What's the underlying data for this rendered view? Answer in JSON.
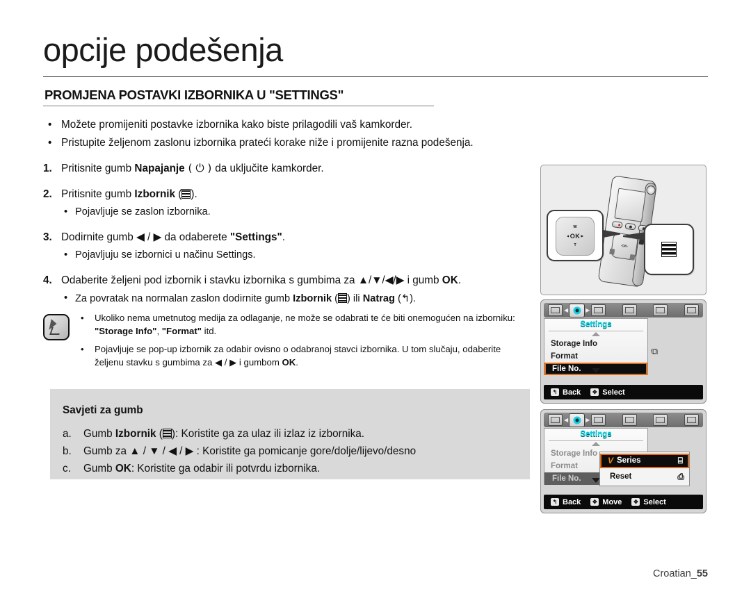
{
  "header": {
    "title": "opcije podešenja",
    "subtitle": "PROMJENA POSTAVKI IZBORNIKA U \"SETTINGS\""
  },
  "intro_bullets": [
    "Možete promijeniti postavke izbornika kako biste prilagodili vaš kamkorder.",
    "Pristupite željenom zaslonu izbornika prateći korake niže i promijenite razna podešenja."
  ],
  "steps": [
    {
      "num": "1.",
      "text_before": "Pritisnite gumb ",
      "bold": "Napajanje",
      "text_after": " (  ) da uključite kamkorder.",
      "sub": []
    },
    {
      "num": "2.",
      "text_before": "Pritisnite gumb ",
      "bold": "Izbornik",
      "text_after": " ( ).",
      "sub": [
        "Pojavljuje se zaslon izbornika."
      ]
    },
    {
      "num": "3.",
      "text_before": "Dodirnite gumb ◀ / ▶ da odaberete ",
      "bold": "\"Settings\"",
      "text_after": ".",
      "sub": [
        "Pojavljuju se izbornici u načinu Settings."
      ]
    },
    {
      "num": "4.",
      "text_before": "Odaberite željeni pod izbornik i stavku izbornika s gumbima za ▲/▼/◀/▶ i gumb ",
      "bold": "OK",
      "text_after": ".",
      "sub": [
        "Za povratak na normalan zaslon dodirnite gumb Izbornik ( ) ili Natrag ( ↰ )."
      ]
    }
  ],
  "note": {
    "icon": "memo-icon",
    "items": [
      "Ukoliko nema umetnutog medija za odlaganje, ne može se odabrati te će biti onemogućen na izborniku: \"Storage Info\", \"Format\" itd.",
      "Pojavljuje se pop-up izbornik za odabir ovisno o odabranoj stavci izbornika. U tom slučaju, odaberite željenu stavku s gumbima za ◀ / ▶ i gumbom OK."
    ]
  },
  "tips": {
    "title": "Savjeti za gumb",
    "items": [
      {
        "label": "a.",
        "text": "Gumb Izbornik ( ): Koristite ga za ulaz ili izlaz iz izbornika."
      },
      {
        "label": "b.",
        "text": "Gumb za ▲ / ▼ / ◀ / ▶ : Koristite ga pomicanje gore/dolje/lijevo/desno"
      },
      {
        "label": "c.",
        "text": "Gumb OK: Koristite ga odabir ili potvrdu izbornika."
      }
    ]
  },
  "camcorder": {
    "pad_callout": {
      "ok": "·OK·",
      "up": "W",
      "down": "T",
      "left": "◂",
      "right": "▸"
    },
    "menu_callout": "menu-bars-icon"
  },
  "lcd_screens": [
    {
      "name": "settings-menu",
      "menu_title": "Settings",
      "items": [
        {
          "label": "Storage Info",
          "selected": false
        },
        {
          "label": "Format",
          "selected": false
        },
        {
          "label": "File No.",
          "selected": true
        }
      ],
      "side_icon": "file-pages-icon",
      "commands": [
        {
          "icon": "back-icon",
          "label": "Back"
        },
        {
          "icon": "pad-icon",
          "label": "Select"
        }
      ],
      "popup": null
    },
    {
      "name": "file-no-popup",
      "menu_title": "Settings",
      "items": [
        {
          "label": "Storage Info",
          "selected": false
        },
        {
          "label": "Format",
          "selected": false
        },
        {
          "label": "File No.",
          "selected": true
        }
      ],
      "side_icon": "",
      "commands": [
        {
          "icon": "back-icon",
          "label": "Back"
        },
        {
          "icon": "pad-icon",
          "label": "Move"
        },
        {
          "icon": "pad-icon",
          "label": "Select"
        }
      ],
      "popup": {
        "rows": [
          {
            "check": "V",
            "label": "Series",
            "icon": "⌸",
            "selected": true
          },
          {
            "check": "",
            "label": "Reset",
            "icon": "⎙",
            "selected": false
          }
        ]
      }
    }
  ],
  "footer": {
    "lang": "Croatian_",
    "page": "55"
  },
  "colors": {
    "accent_orange": "#e06a16",
    "menu_cyan": "#17d7e8",
    "tips_bg": "#d9d9d9"
  }
}
